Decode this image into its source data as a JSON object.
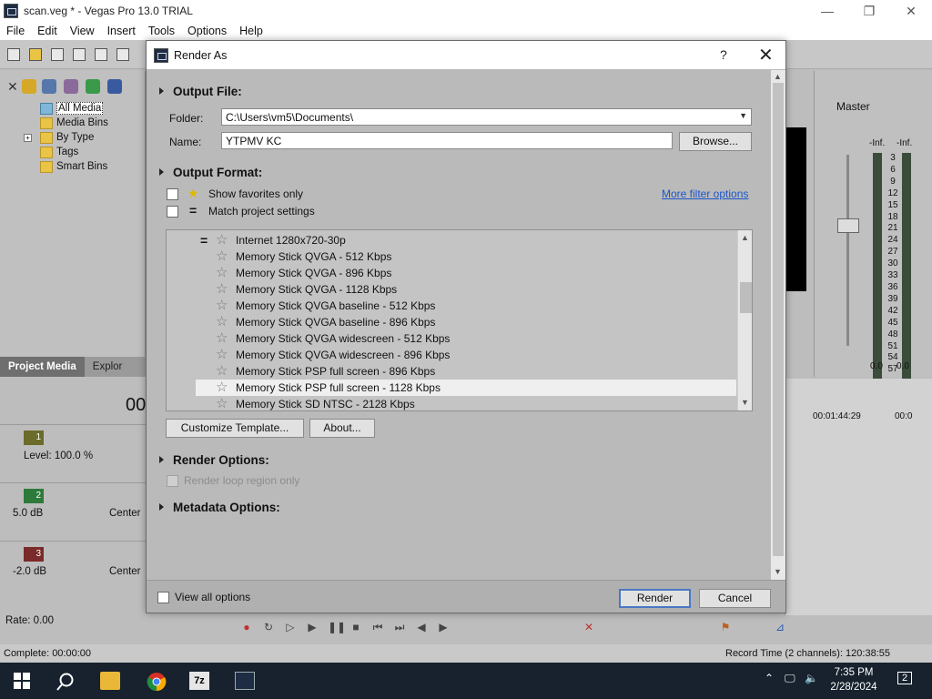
{
  "window": {
    "title": "scan.veg * - Vegas Pro 13.0 TRIAL",
    "min": "—",
    "max": "❐",
    "close": "✕"
  },
  "menu": [
    "File",
    "Edit",
    "View",
    "Insert",
    "Tools",
    "Options",
    "Help"
  ],
  "explorer": {
    "tree": [
      "All Media",
      "Media Bins",
      "By Type",
      "Tags",
      "Smart Bins"
    ],
    "tabs": [
      "Project Media",
      "Explor"
    ]
  },
  "tracks": {
    "time": "00",
    "level": "Level: 100.0 %",
    "t1": "1",
    "t2": "2",
    "t3": "3",
    "db2": "5.0 dB",
    "db3": "-2.0 dB",
    "center2": "Center",
    "center3": "Center"
  },
  "master": {
    "label": "Master",
    "inf_left": "-Inf.",
    "inf_right": "-Inf.",
    "scale": [
      "3",
      "6",
      "9",
      "12",
      "15",
      "18",
      "21",
      "24",
      "27",
      "30",
      "33",
      "36",
      "39",
      "42",
      "45",
      "48",
      "51",
      "54",
      "57"
    ],
    "val_left": "0.0",
    "val_right": "0.0"
  },
  "timeline": {
    "mark1": "00:01:44:29",
    "mark2": "00:0"
  },
  "status": {
    "rate": "Rate: 0.00",
    "complete": "Complete: 00:00:00",
    "record": "Record Time (2 channels): 120:38:55"
  },
  "taskbar": {
    "time": "7:35 PM",
    "date": "2/28/2024",
    "notif": "2"
  },
  "dialog": {
    "title": "Render As",
    "help": "?",
    "close": "✕",
    "output_file": "Output File:",
    "folder_label": "Folder:",
    "folder_value": "C:\\Users\\vm5\\Documents\\",
    "name_label": "Name:",
    "name_value": "YTPMV KC",
    "browse": "Browse...",
    "output_format": "Output Format:",
    "show_favorites": "Show favorites only",
    "match_project": "Match project settings",
    "more_filter": "More filter options",
    "formats": [
      "Internet 1280x720-30p",
      "Memory Stick QVGA - 512 Kbps",
      "Memory Stick QVGA - 896 Kbps",
      "Memory Stick QVGA - 1128 Kbps",
      "Memory Stick QVGA baseline - 512 Kbps",
      "Memory Stick QVGA baseline - 896 Kbps",
      "Memory Stick QVGA widescreen - 512 Kbps",
      "Memory Stick QVGA widescreen - 896 Kbps",
      "Memory Stick PSP full screen - 896 Kbps",
      "Memory Stick PSP full screen - 1128 Kbps",
      "Memory Stick SD NTSC - 2128 Kbps"
    ],
    "customize": "Customize Template...",
    "about": "About...",
    "render_options": "Render Options:",
    "render_loop": "Render loop region only",
    "metadata_options": "Metadata Options:",
    "view_all": "View all options",
    "render": "Render",
    "cancel": "Cancel"
  }
}
